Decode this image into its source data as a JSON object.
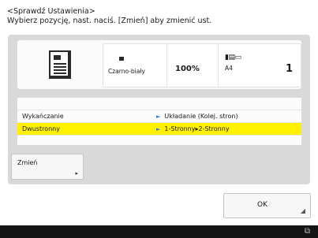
{
  "header": {
    "line1": "<Sprawdź Ustawienia>",
    "line2": "Wybierz pozycję, nast. naciś. [Zmień] aby zmienić ust."
  },
  "summary": {
    "color_mode": "Czarno-biały",
    "zoom": "100%",
    "paper_icon": "▮▤▭",
    "paper_size": "A4",
    "copies": "1"
  },
  "settings": [
    {
      "label": "Wykańczanie",
      "value": "Układanie (Kolej. stron)",
      "selected": false
    },
    {
      "label": "Dwustronny",
      "value": "1-Stronny▸2-Stronny",
      "selected": true
    }
  ],
  "buttons": {
    "change": "Zmień",
    "ok": "OK"
  },
  "icons": {
    "value_arrow": "►",
    "corner": "◢",
    "status": "⧉"
  },
  "colors": {
    "selected_row": "#fff100",
    "arrow": "#2f7fd1",
    "panel_bg": "#d9d9d9"
  }
}
